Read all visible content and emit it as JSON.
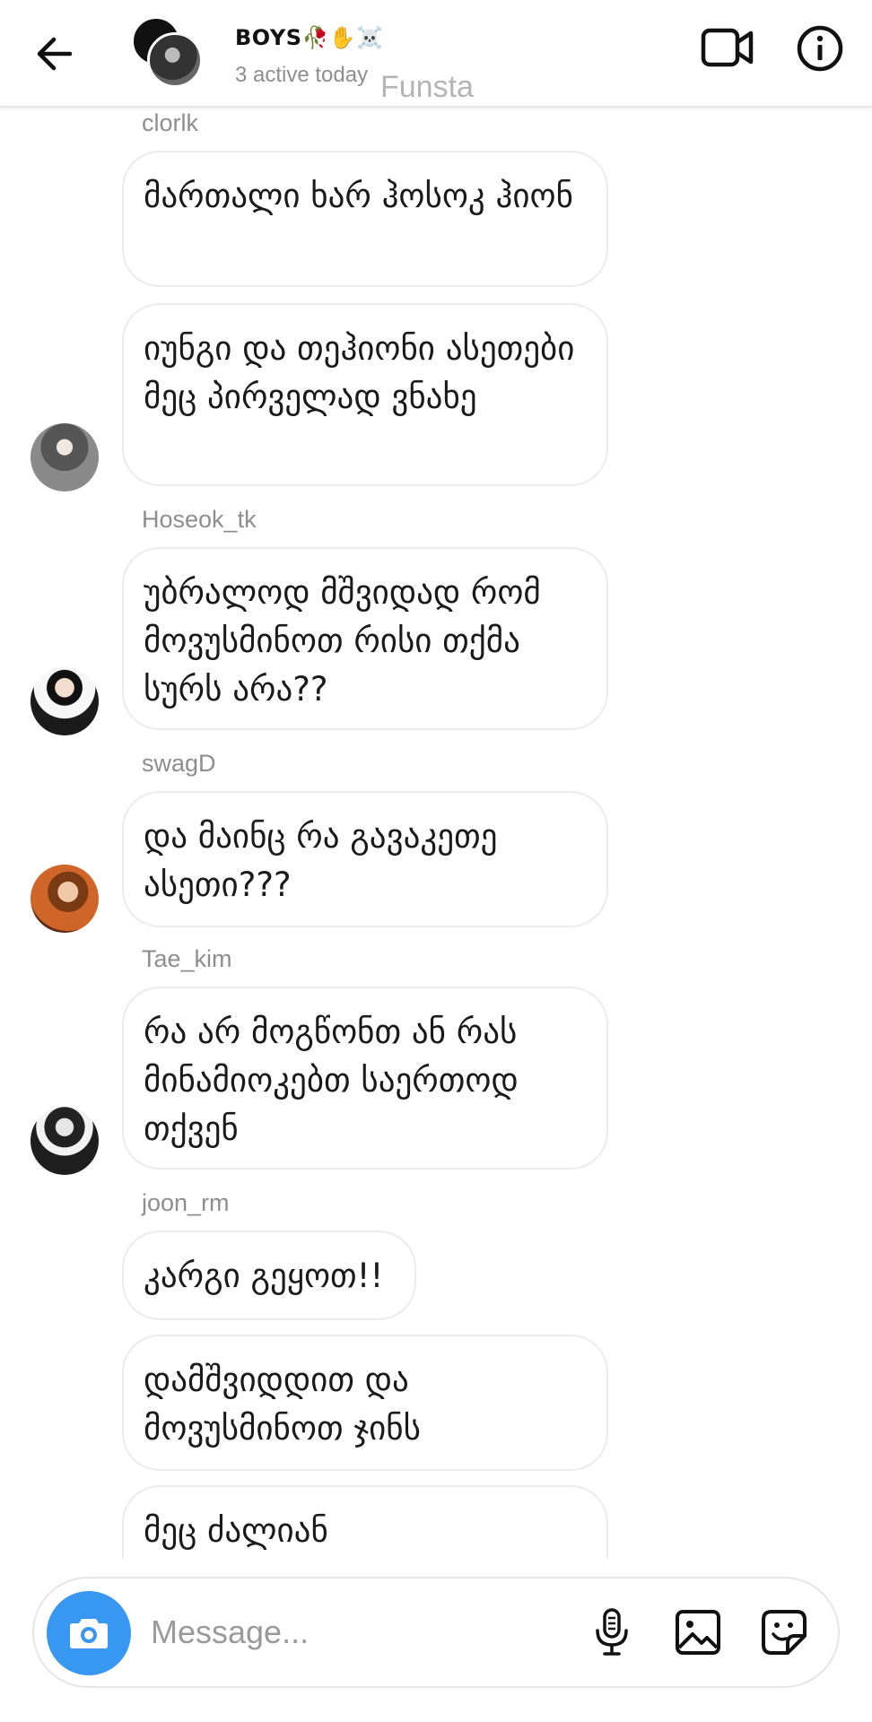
{
  "header": {
    "group_name": "BOYS🥀✋☠️",
    "status": "3 active today",
    "watermark": "Funsta",
    "icons": [
      "back-arrow-icon",
      "video-call-icon",
      "info-icon"
    ]
  },
  "messages": [
    {
      "sender": "clorlk",
      "text": "მართალი ხარ ჰოსოკ ჰიონ"
    },
    {
      "sender": "",
      "text": "იუნგი და თეჰიონი ასეთები მეც პირველად ვნახე"
    },
    {
      "sender": "Hoseok_tk",
      "text": "უბრალოდ მშვიდად რომ მოვუსმინოთ რისი თქმა სურს არა??"
    },
    {
      "sender": "swagD",
      "text": "და მაინც რა გავაკეთე ასეთი???"
    },
    {
      "sender": "Tae_kim",
      "text": "რა არ მოგწონთ ან რას მინამიოკებთ საერთოდ თქვენ"
    },
    {
      "sender": "joon_rm",
      "text": "კარგი გეყოთ!!"
    },
    {
      "sender": "",
      "text": "დამშვიდდით და მოვუსმინოთ ჯინს"
    },
    {
      "sender": "",
      "text": "მეც ძალიან"
    }
  ],
  "composer": {
    "placeholder": "Message...",
    "accent": "#3897f0",
    "icons": [
      "camera-icon",
      "microphone-icon",
      "gallery-icon",
      "sticker-icon"
    ]
  }
}
